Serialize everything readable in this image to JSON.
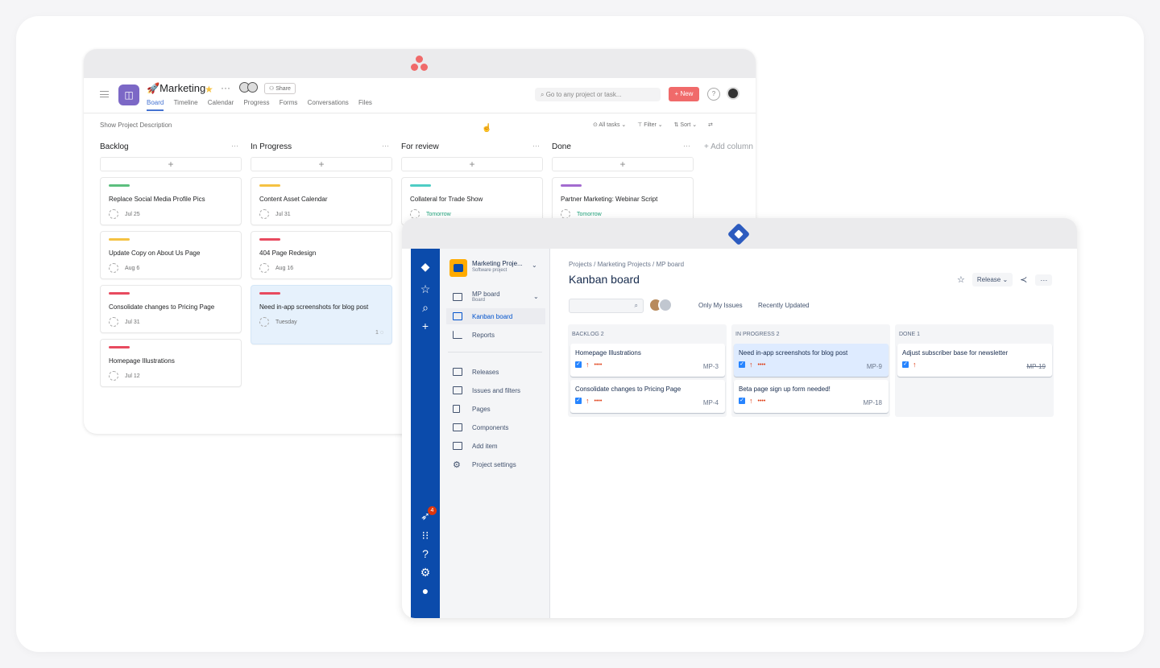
{
  "asana": {
    "project_title": "🚀Marketing",
    "project_icon": "◫",
    "more": "···",
    "share_label": "Share",
    "tabs": [
      "Board",
      "Timeline",
      "Calendar",
      "Progress",
      "Forms",
      "Conversations",
      "Files"
    ],
    "search_placeholder": "Go to any project or task...",
    "new_label": "+ New",
    "help": "?",
    "show_description": "Show Project Description",
    "toolbar": {
      "all_tasks": "⊙ All tasks ⌄",
      "filter": "⊤ Filter ⌄",
      "sort": "⇅ Sort ⌄",
      "swap": "⇄"
    },
    "add_column": "+ Add column",
    "columns": [
      {
        "name": "Backlog",
        "cards": [
          {
            "color": "#5cbf7e",
            "title": "Replace Social Media Profile Pics",
            "date": "Jul 25"
          },
          {
            "color": "#f5c242",
            "title": "Update Copy on About Us Page",
            "date": "Aug 6"
          },
          {
            "color": "#e84a5f",
            "title": "Consolidate changes to Pricing Page",
            "date": "Jul 31"
          },
          {
            "color": "#e84a5f",
            "title": "Homepage Illustrations",
            "date": "Jul 12"
          }
        ]
      },
      {
        "name": "In Progress",
        "cards": [
          {
            "color": "#f5c242",
            "title": "Content Asset Calendar",
            "date": "Jul 31"
          },
          {
            "color": "#e84a5f",
            "title": "404 Page Redesign",
            "date": "Aug 16"
          },
          {
            "color": "#e84a5f",
            "title": "Need in-app screenshots for blog post",
            "date": "Tuesday",
            "comments": "1 ◌"
          }
        ]
      },
      {
        "name": "For review",
        "cards": [
          {
            "color": "#4ecdc4",
            "title": "Collateral for Trade Show",
            "date": "Tomorrow"
          }
        ]
      },
      {
        "name": "Done",
        "cards": [
          {
            "color": "#a36bd0",
            "title": "Partner Marketing: Webinar Script",
            "date": "Tomorrow"
          }
        ]
      }
    ]
  },
  "jira": {
    "project_name": "Marketing Proje...",
    "project_type": "Software project",
    "nav_items": {
      "mp_board": "MP board",
      "mp_board_sub": "Board",
      "kanban": "Kanban board",
      "reports": "Reports",
      "releases": "Releases",
      "issues": "Issues and filters",
      "pages": "Pages",
      "components": "Components",
      "add_item": "Add item",
      "settings": "Project settings"
    },
    "notification_count": "4",
    "breadcrumb": "Projects  /  Marketing Projects  /  MP board",
    "title": "Kanban board",
    "release_label": "Release ⌄",
    "more": "···",
    "filters": [
      "Only My Issues",
      "Recently Updated"
    ],
    "columns": [
      {
        "name": "BACKLOG 2",
        "cards": [
          {
            "title": "Homepage Illustrations",
            "key": "MP-3"
          },
          {
            "title": "Consolidate changes to Pricing Page",
            "key": "MP-4"
          }
        ]
      },
      {
        "name": "IN PROGRESS 2",
        "cards": [
          {
            "title": "Need in-app screenshots for blog post",
            "key": "MP-9"
          },
          {
            "title": "Beta page sign up form needed!",
            "key": "MP-18"
          }
        ]
      },
      {
        "name": "DONE 1",
        "cards": [
          {
            "title": "Adjust subscriber base for newsletter",
            "key": "MP-19"
          }
        ]
      }
    ]
  }
}
